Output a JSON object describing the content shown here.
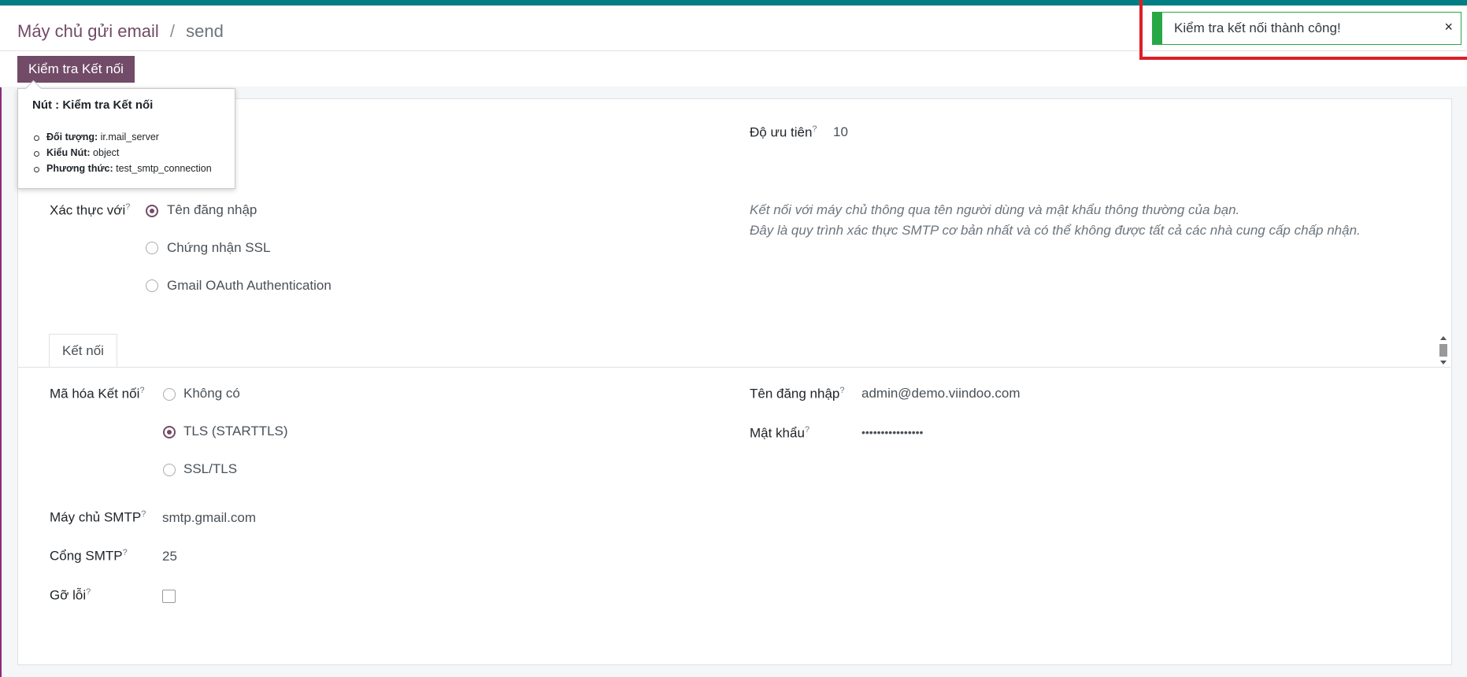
{
  "breadcrumb": {
    "parent": "Máy chủ gửi email",
    "separator": "/",
    "current": "send"
  },
  "toolbar": {
    "test_button_label": "Kiểm tra Kết nối"
  },
  "tooltip": {
    "title": "Nút : Kiểm tra Kết nối",
    "items": [
      {
        "key": "Đối tượng:",
        "value": "ir.mail_server"
      },
      {
        "key": "Kiểu Nút:",
        "value": "object"
      },
      {
        "key": "Phương thức:",
        "value": "test_smtp_connection"
      }
    ]
  },
  "form": {
    "priority_label": "Độ ưu tiên",
    "priority_value": "10",
    "auth_label": "Xác thực với",
    "auth_options": [
      "Tên đăng nhập",
      "Chứng nhận SSL",
      "Gmail OAuth Authentication"
    ],
    "auth_selected": "Tên đăng nhập",
    "auth_help_line1": "Kết nối với máy chủ thông qua tên người dùng và mật khẩu thông thường của bạn.",
    "auth_help_line2": "Đây là quy trình xác thực SMTP cơ bản nhất và có thể không được tất cả các nhà cung cấp chấp nhận.",
    "tab_label": "Kết nối",
    "encryption_label": "Mã hóa Kết nối",
    "encryption_options": [
      "Không có",
      "TLS (STARTTLS)",
      "SSL/TLS"
    ],
    "encryption_selected": "TLS (STARTTLS)",
    "smtp_server_label": "Máy chủ SMTP",
    "smtp_server_value": "smtp.gmail.com",
    "smtp_port_label": "Cổng SMTP",
    "smtp_port_value": "25",
    "debug_label": "Gỡ lỗi",
    "username_label": "Tên đăng nhập",
    "username_value": "admin@demo.viindoo.com",
    "password_label": "Mật khẩu",
    "password_value": "••••••••••••••••",
    "help_marker": "?"
  },
  "toast": {
    "message": "Kiểm tra kết nối thành công!",
    "close": "×"
  },
  "colors": {
    "brand": "#714b67",
    "topbar": "#017e84",
    "success": "#28a745",
    "highlight": "#dd1f26"
  },
  "icons": {
    "toast_close": "close-icon",
    "tab_scroll": "scrollbar"
  }
}
